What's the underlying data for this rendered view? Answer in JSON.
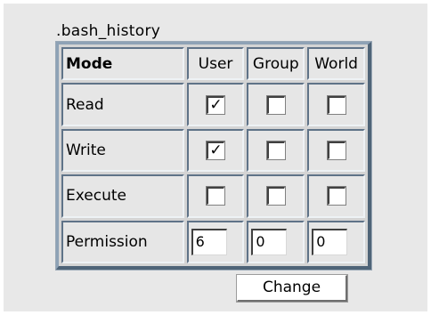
{
  "file": {
    "name": ".bash_history"
  },
  "table": {
    "header": {
      "mode": "Mode",
      "user": "User",
      "group": "Group",
      "world": "World"
    },
    "rows": [
      {
        "label": "Read",
        "user": true,
        "group": false,
        "world": false
      },
      {
        "label": "Write",
        "user": true,
        "group": false,
        "world": false
      },
      {
        "label": "Execute",
        "user": false,
        "group": false,
        "world": false
      }
    ],
    "permission": {
      "label": "Permission",
      "user": "6",
      "group": "0",
      "world": "0"
    }
  },
  "button": {
    "change_label": "Change"
  },
  "glyphs": {
    "checked": "✓"
  }
}
